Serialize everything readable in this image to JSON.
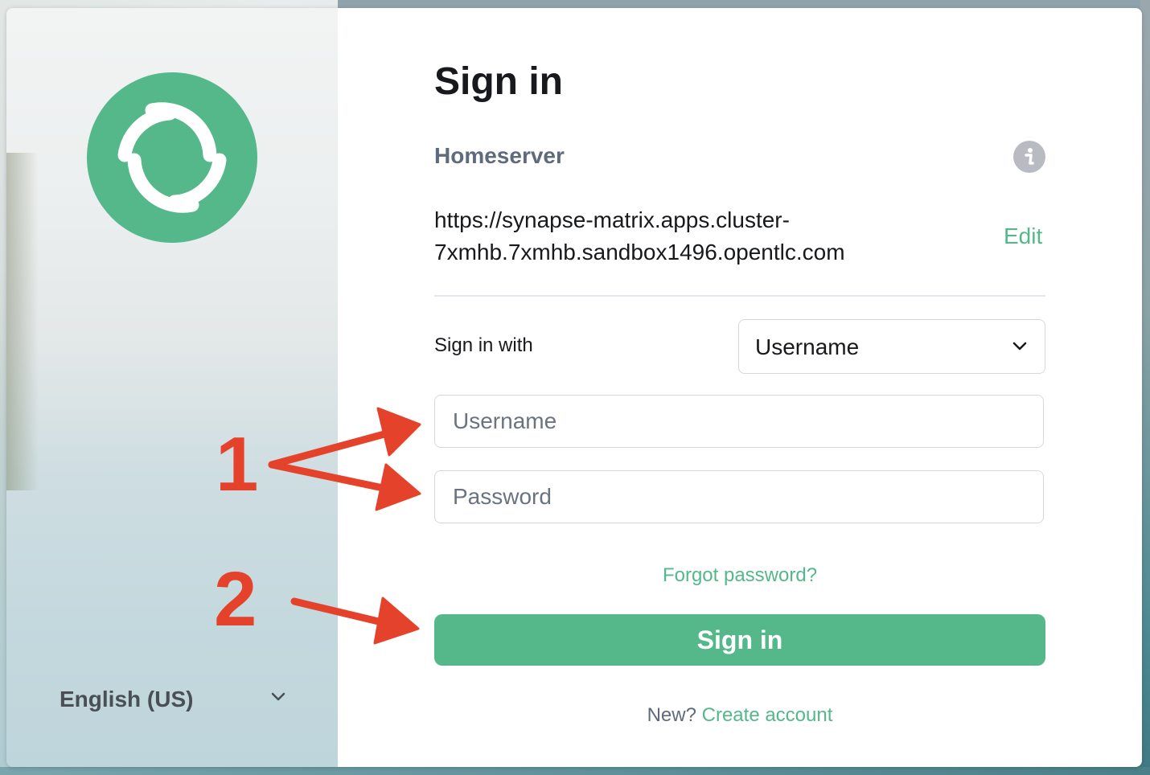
{
  "branding": {
    "logo_icon": "element-logo-icon",
    "accent_color": "#54b88b"
  },
  "language": {
    "selected": "English (US)",
    "chevron_icon": "chevron-down-icon"
  },
  "login": {
    "title": "Sign in",
    "homeserver": {
      "label": "Homeserver",
      "info_icon": "info-icon",
      "url_line1": "https://synapse-matrix.apps.cluster-",
      "url_line2": "7xmhb.7xmhb.sandbox1496.opentlc.com",
      "edit_label": "Edit"
    },
    "sign_in_with": {
      "label": "Sign in with",
      "selected_method": "Username"
    },
    "fields": {
      "username_placeholder": "Username",
      "username_value": "",
      "password_placeholder": "Password",
      "password_value": ""
    },
    "forgot_password": "Forgot password?",
    "submit_label": "Sign in",
    "new_prompt": "New?",
    "create_account": "Create account"
  },
  "annotations": {
    "step1": "1",
    "step2": "2",
    "color": "#e5422b"
  }
}
